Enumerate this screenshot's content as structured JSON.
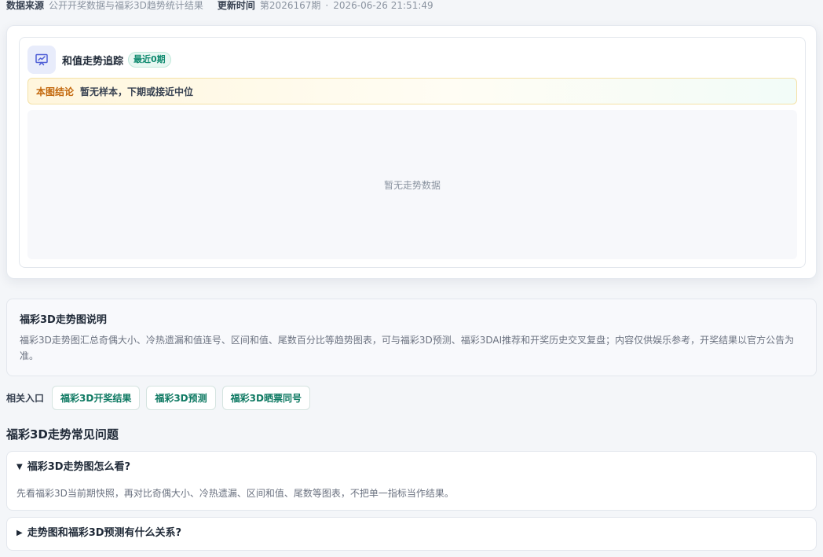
{
  "meta": {
    "source_label": "数据来源",
    "source_value": "公开开奖数据与福彩3D趋势统计结果",
    "update_label": "更新时间",
    "update_issue": "第2026167期",
    "separator": "·",
    "update_time": "2026-06-26 21:51:49"
  },
  "trend_card": {
    "icon": "presentation-chart-icon",
    "title": "和值走势追踪",
    "badge": "最近0期",
    "conclusion_tag": "本图结论",
    "conclusion_text": "暂无样本，下期或接近中位",
    "empty_text": "暂无走势数据"
  },
  "description": {
    "title": "福彩3D走势图说明",
    "body": "福彩3D走势图汇总奇偶大小、冷热遗漏和值连号、区间和值、尾数百分比等趋势图表，可与福彩3D预测、福彩3DAI推荐和开奖历史交叉复盘；内容仅供娱乐参考，开奖结果以官方公告为准。"
  },
  "related": {
    "label": "相关入口",
    "links": [
      "福彩3D开奖结果",
      "福彩3D预测",
      "福彩3D晒票同号"
    ]
  },
  "faq": {
    "heading": "福彩3D走势常见问题",
    "items": [
      {
        "marker": "▼",
        "question": "福彩3D走势图怎么看?",
        "answer": "先看福彩3D当前期快照，再对比奇偶大小、冷热遗漏、区间和值、尾数等图表，不把单一指标当作结果。"
      },
      {
        "marker": "▶",
        "question": "走势图和福彩3D预测有什么关系?"
      }
    ]
  },
  "colors": {
    "accent_green": "#0f7a63",
    "conclusion_orange": "#c2660a",
    "icon_bg": "#e8ecfb"
  }
}
